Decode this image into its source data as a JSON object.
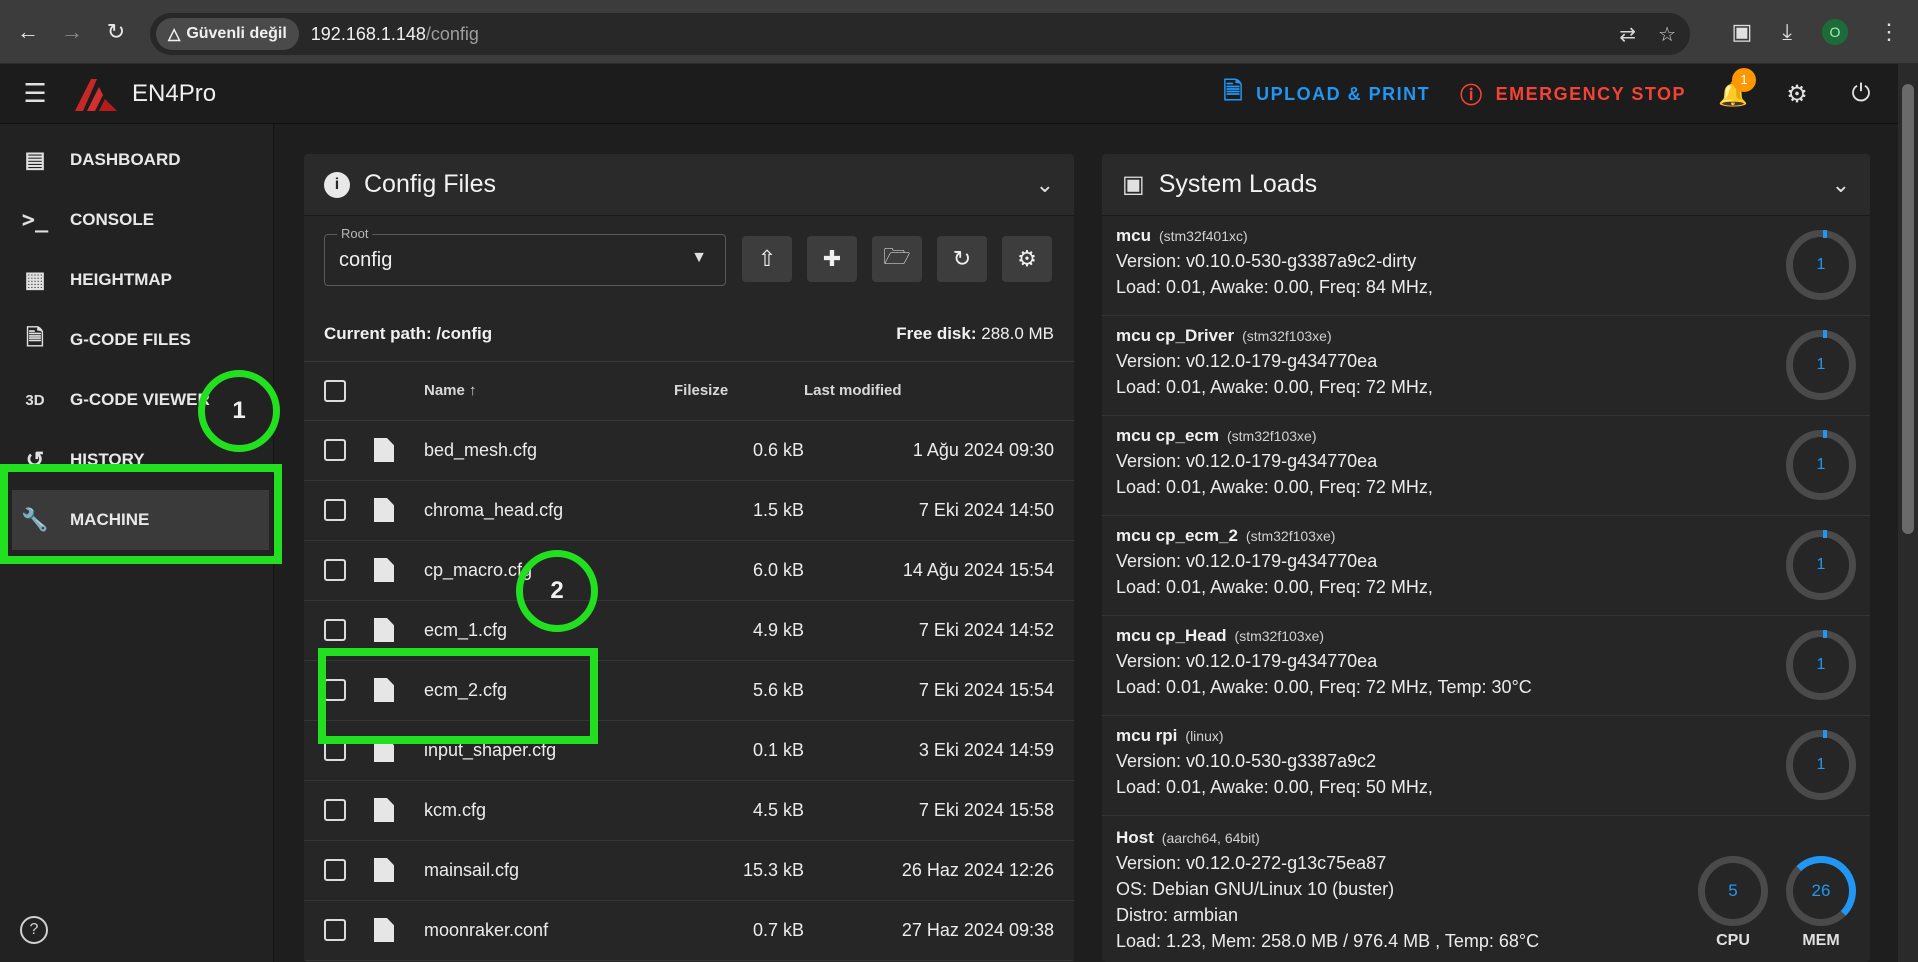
{
  "browser": {
    "security_label": "Güvenli değil",
    "url_host": "192.168.1.148",
    "url_path": "/config",
    "profile_initial": "O"
  },
  "header": {
    "app_title": "EN4Pro",
    "upload_label": "UPLOAD & PRINT",
    "estop_label": "EMERGENCY STOP",
    "notification_count": "1"
  },
  "sidebar": {
    "items": [
      {
        "label": "DASHBOARD",
        "icon": "monitor-dashboard-icon"
      },
      {
        "label": "CONSOLE",
        "icon": "console-icon"
      },
      {
        "label": "HEIGHTMAP",
        "icon": "grid-icon"
      },
      {
        "label": "G-CODE FILES",
        "icon": "file-document-icon"
      },
      {
        "label": "G-CODE VIEWER",
        "icon": "3d-icon"
      },
      {
        "label": "HISTORY",
        "icon": "history-icon"
      },
      {
        "label": "MACHINE",
        "icon": "wrench-icon"
      }
    ],
    "viewer_icon_text": "3D"
  },
  "annotations": {
    "circle1": "1",
    "circle2": "2"
  },
  "config_files": {
    "title": "Config Files",
    "root_label": "Root",
    "root_value": "config",
    "current_path_label": "Current path:",
    "current_path": "/config",
    "free_disk_label": "Free disk:",
    "free_disk": "288.0 MB",
    "columns": {
      "name": "Name",
      "filesize": "Filesize",
      "modified": "Last modified"
    },
    "files": [
      {
        "name": "bed_mesh.cfg",
        "size": "0.6 kB",
        "modified": "1 Ağu 2024 09:30"
      },
      {
        "name": "chroma_head.cfg",
        "size": "1.5 kB",
        "modified": "7 Eki 2024 14:50"
      },
      {
        "name": "cp_macro.cfg",
        "size": "6.0 kB",
        "modified": "14 Ağu 2024 15:54"
      },
      {
        "name": "ecm_1.cfg",
        "size": "4.9 kB",
        "modified": "7 Eki 2024 14:52"
      },
      {
        "name": "ecm_2.cfg",
        "size": "5.6 kB",
        "modified": "7 Eki 2024 15:54"
      },
      {
        "name": "input_shaper.cfg",
        "size": "0.1 kB",
        "modified": "3 Eki 2024 14:59"
      },
      {
        "name": "kcm.cfg",
        "size": "4.5 kB",
        "modified": "7 Eki 2024 15:58"
      },
      {
        "name": "mainsail.cfg",
        "size": "15.3 kB",
        "modified": "26 Haz 2024 12:26"
      },
      {
        "name": "moonraker.conf",
        "size": "0.7 kB",
        "modified": "27 Haz 2024 09:38"
      }
    ]
  },
  "system_loads": {
    "title": "System Loads",
    "mcus": [
      {
        "name": "mcu",
        "chip": "(stm32f401xc)",
        "version": "Version: v0.10.0-530-g3387a9c2-dirty",
        "load": "Load: 0.01, Awake: 0.00, Freq: 84 MHz,",
        "gauge": "1"
      },
      {
        "name": "mcu cp_Driver",
        "chip": "(stm32f103xe)",
        "version": "Version: v0.12.0-179-g434770ea",
        "load": "Load: 0.01, Awake: 0.00, Freq: 72 MHz,",
        "gauge": "1"
      },
      {
        "name": "mcu cp_ecm",
        "chip": "(stm32f103xe)",
        "version": "Version: v0.12.0-179-g434770ea",
        "load": "Load: 0.01, Awake: 0.00, Freq: 72 MHz,",
        "gauge": "1"
      },
      {
        "name": "mcu cp_ecm_2",
        "chip": "(stm32f103xe)",
        "version": "Version: v0.12.0-179-g434770ea",
        "load": "Load: 0.01, Awake: 0.00, Freq: 72 MHz,",
        "gauge": "1"
      },
      {
        "name": "mcu cp_Head",
        "chip": "(stm32f103xe)",
        "version": "Version: v0.12.0-179-g434770ea",
        "load": "Load: 0.01, Awake: 0.00, Freq: 72 MHz, Temp: 30°C",
        "gauge": "1"
      },
      {
        "name": "mcu rpi",
        "chip": "(linux)",
        "version": "Version: v0.10.0-530-g3387a9c2",
        "load": "Load: 0.01, Awake: 0.00, Freq: 50 MHz,",
        "gauge": "1"
      }
    ],
    "host": {
      "name": "Host",
      "chip": "(aarch64, 64bit)",
      "version": "Version: v0.12.0-272-g13c75ea87",
      "os": "OS: Debian GNU/Linux 10 (buster)",
      "distro": "Distro: armbian",
      "load": "Load: 1.23, Mem: 258.0 MB / 976.4 MB , Temp: 68°C",
      "cpu_value": "5",
      "cpu_label": "CPU",
      "mem_value": "26",
      "mem_label": "MEM"
    }
  },
  "colors": {
    "accent_blue": "#2196f3",
    "estop_red": "#f44336",
    "annotation_green": "#22e020",
    "badge_orange": "#ff9800"
  }
}
